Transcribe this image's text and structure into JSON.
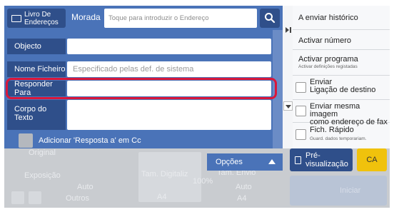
{
  "top_bar": {
    "address_book_label": "Livro De Endereços",
    "morada_label": "Morada",
    "morada_placeholder": "Toque para introduzir o Endereço"
  },
  "fields": {
    "object_label": "Objecto",
    "object_value": "",
    "filename_label": "Nome Ficheiro",
    "filename_placeholder": "Especificado pelas def. de sistema",
    "reply_to_label": "Responder Para",
    "reply_to_value": "",
    "body_label": "Corpo do Texto",
    "cc_label": "Adicionar 'Resposta a' em Cc"
  },
  "options_label": "Opções",
  "right_menu": {
    "send_history": "A enviar histórico",
    "activate_number": "Activar número",
    "activate_program": "Activar programa",
    "activate_program_sub": "Activar definições registadas",
    "send_dest_link_1": "Enviar",
    "send_dest_link_2": "Ligação de destino",
    "send_same_image_1": "Enviar mesma imagem",
    "send_same_image_2": "como endereço de fax",
    "quick_file_1": "Fich. Rápido",
    "quick_file_sub": "Guard. dados temporariam."
  },
  "preview_label": "Pré-visualização",
  "ca_label": "CA",
  "background": {
    "original": "Original",
    "exposure": "Exposição",
    "exposure_value": "Auto",
    "others": "Outros",
    "scan_size": "Tam. Digitaliz",
    "scan_size_value": "A4",
    "send_size": "Tam. Envio",
    "send_size_value": "A4",
    "ratio": "100%",
    "send_size_auto": "Auto",
    "start": "Iniciar"
  },
  "colors": {
    "panel_blue": "#4a73b8",
    "label_dark_blue": "#2f4f8a",
    "highlight_red": "#d9173b",
    "ca_yellow": "#f0c20c"
  }
}
